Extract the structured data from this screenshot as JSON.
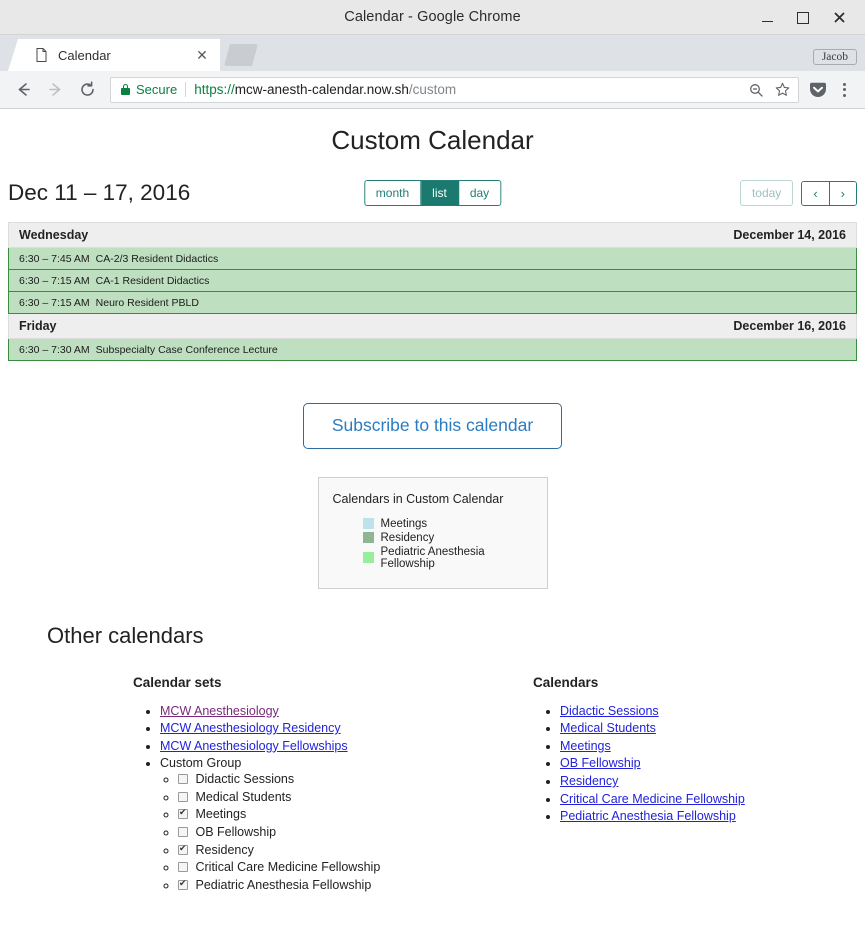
{
  "window": {
    "title": "Calendar - Google Chrome",
    "minimize_label": "–",
    "maximize_label": "□",
    "close_label": "✕"
  },
  "tabs": [
    {
      "title": "Calendar",
      "favicon": "document-icon",
      "close_label": "✕"
    }
  ],
  "newtab_label": "+",
  "profile": {
    "name": "Jacob"
  },
  "toolbar": {
    "back_label": "←",
    "forward_label": "→",
    "reload_label": "⟳",
    "security_text": "Secure",
    "url_scheme": "https://",
    "url_host": "mcw-anesth-calendar.now.sh",
    "url_path": "/custom",
    "zoom_icon": "zoom-out-icon",
    "bookmark_icon": "star-icon",
    "pocket_icon": "pocket-icon",
    "menu_icon": "three-dot-menu-icon"
  },
  "page": {
    "title": "Custom Calendar",
    "date_range": "Dec 11 – 17, 2016",
    "views": [
      {
        "label": "month",
        "active": false
      },
      {
        "label": "list",
        "active": true
      },
      {
        "label": "day",
        "active": false
      }
    ],
    "today_label": "today",
    "prev_label": "‹",
    "next_label": "›",
    "subscribe_label": "Subscribe to this calendar"
  },
  "schedule": [
    {
      "weekday": "Wednesday",
      "date": "December 14, 2016",
      "events": [
        {
          "time": "6:30 – 7:45 AM",
          "title": "CA-2/3 Resident Didactics"
        },
        {
          "time": "6:30 – 7:15 AM",
          "title": "CA-1 Resident Didactics"
        },
        {
          "time": "6:30 – 7:15 AM",
          "title": "Neuro Resident PBLD"
        }
      ]
    },
    {
      "weekday": "Friday",
      "date": "December 16, 2016",
      "events": [
        {
          "time": "6:30 – 7:30 AM",
          "title": "Subspecialty Case Conference Lecture"
        }
      ]
    }
  ],
  "legend": {
    "title": "Calendars in Custom Calendar",
    "items": [
      {
        "label": "Meetings",
        "color": "#bde3ea"
      },
      {
        "label": "Residency",
        "color": "#8fb595"
      },
      {
        "label": "Pediatric Anesthesia Fellowship",
        "color": "#97ee9b"
      }
    ]
  },
  "other": {
    "heading": "Other calendars",
    "sets_heading": "Calendar sets",
    "sets": [
      {
        "label": "MCW Anesthesiology",
        "type": "link",
        "visited": true
      },
      {
        "label": "MCW Anesthesiology Residency",
        "type": "link",
        "visited": false
      },
      {
        "label": "MCW Anesthesiology Fellowships",
        "type": "link",
        "visited": false
      },
      {
        "label": "Custom Group",
        "type": "text",
        "visited": false
      }
    ],
    "custom_group": [
      {
        "label": "Didactic Sessions",
        "checked": false
      },
      {
        "label": "Medical Students",
        "checked": false
      },
      {
        "label": "Meetings",
        "checked": true
      },
      {
        "label": "OB Fellowship",
        "checked": false
      },
      {
        "label": "Residency",
        "checked": true
      },
      {
        "label": "Critical Care Medicine Fellowship",
        "checked": false
      },
      {
        "label": "Pediatric Anesthesia Fellowship",
        "checked": true
      }
    ],
    "calendars_heading": "Calendars",
    "calendars": [
      {
        "label": "Didactic Sessions"
      },
      {
        "label": "Medical Students"
      },
      {
        "label": "Meetings"
      },
      {
        "label": "OB Fellowship"
      },
      {
        "label": "Residency"
      },
      {
        "label": "Critical Care Medicine Fellowship"
      },
      {
        "label": "Pediatric Anesthesia Fellowship"
      }
    ]
  },
  "colors": {
    "accent_teal": "#1b7a70",
    "event_bg": "#bfdfc1",
    "event_border": "#3a8c3f",
    "link": "#2222dd",
    "visited_link": "#7a2a7a",
    "secure_green": "#0b8043"
  }
}
